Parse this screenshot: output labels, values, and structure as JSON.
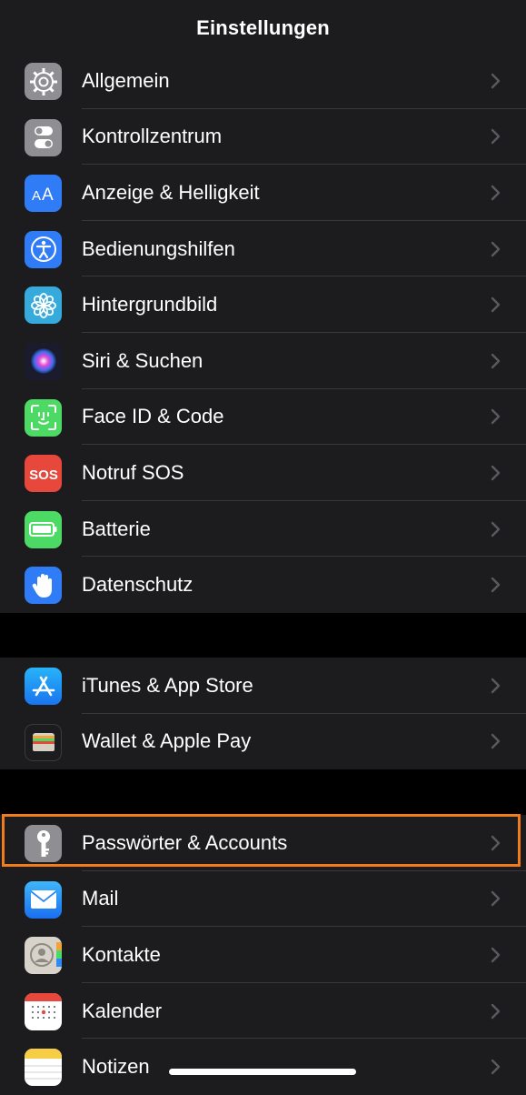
{
  "nav": {
    "title": "Einstellungen"
  },
  "groups": [
    {
      "items": [
        {
          "label": "Allgemein",
          "icon": "gear-icon",
          "color": "#8e8e93"
        },
        {
          "label": "Kontrollzentrum",
          "icon": "toggle-icon",
          "color": "#8e8e93"
        },
        {
          "label": "Anzeige & Helligkeit",
          "icon": "text-size-icon",
          "color": "#2f7cf6"
        },
        {
          "label": "Bedienungshilfen",
          "icon": "accessibility-icon",
          "color": "#2f7cf6"
        },
        {
          "label": "Hintergrundbild",
          "icon": "flower-icon",
          "color": "#36aadc"
        },
        {
          "label": "Siri & Suchen",
          "icon": "siri-icon",
          "color": "#1b1b2e"
        },
        {
          "label": "Face ID & Code",
          "icon": "face-id-icon",
          "color": "#4cd964"
        },
        {
          "label": "Notruf SOS",
          "icon": "sos-icon",
          "color": "#e8473b"
        },
        {
          "label": "Batterie",
          "icon": "battery-icon",
          "color": "#4cd964"
        },
        {
          "label": "Datenschutz",
          "icon": "hand-icon",
          "color": "#2f7cf6"
        }
      ]
    },
    {
      "items": [
        {
          "label": "iTunes & App Store",
          "icon": "app-store-icon",
          "color": "#1f8ef1"
        },
        {
          "label": "Wallet & Apple Pay",
          "icon": "wallet-icon",
          "color": "#1c1c1e"
        }
      ]
    },
    {
      "items": [
        {
          "label": "Passwörter & Accounts",
          "icon": "key-icon",
          "color": "#8e8e93"
        },
        {
          "label": "Mail",
          "icon": "mail-icon",
          "color": "#2f8af5"
        },
        {
          "label": "Kontakte",
          "icon": "contacts-icon",
          "color": "#d7d3ca"
        },
        {
          "label": "Kalender",
          "icon": "calendar-icon",
          "color": "#ffffff"
        },
        {
          "label": "Notizen",
          "icon": "notes-icon",
          "color": "#ffffff"
        }
      ]
    }
  ],
  "highlight_color": "#f07c1b"
}
